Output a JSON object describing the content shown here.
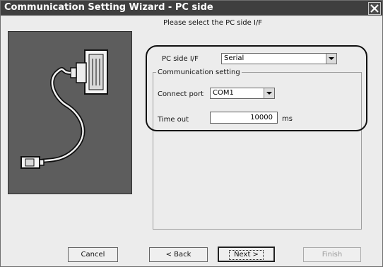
{
  "window": {
    "title": "Communication Setting Wizard - PC side"
  },
  "icons": {
    "close": "close-icon",
    "dropdown": "chevron-down-icon",
    "cable": "serial-cable-picture"
  },
  "prompt": "Please select the PC side I/F",
  "pc_side_if": {
    "label": "PC side I/F",
    "value": "Serial"
  },
  "communication_setting": {
    "title": "Communication setting",
    "connect_port": {
      "label": "Connect port",
      "value": "COM1"
    },
    "time_out": {
      "label": "Time out",
      "value": "10000",
      "unit": "ms"
    }
  },
  "buttons": {
    "cancel": "Cancel",
    "back": "< Back",
    "next": "Next >",
    "finish": "Finish"
  },
  "colors": {
    "titlebar": "#3f3f3f",
    "dialog_bg": "#ececec",
    "picture_bg": "#5d5d5d",
    "highlight": "#111111"
  }
}
